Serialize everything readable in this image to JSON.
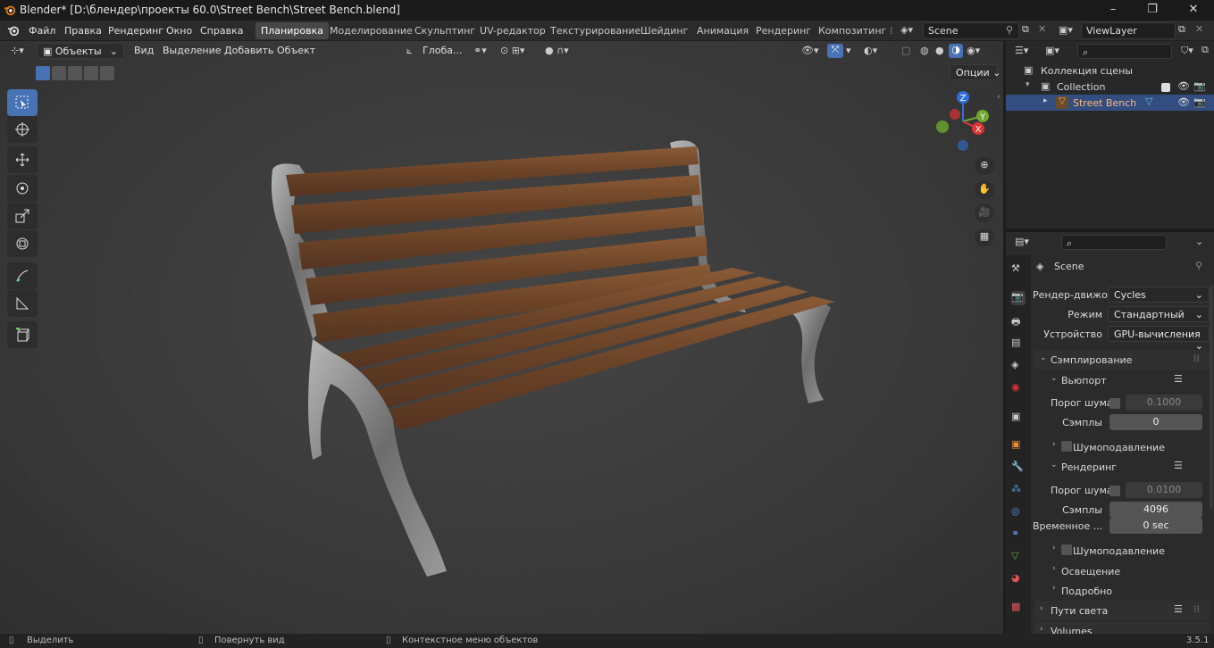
{
  "titlebar": {
    "title": "Blender* [D:\\блендер\\проекты 60.0\\Street Bench\\Street Bench.blend]"
  },
  "menu": [
    "Файл",
    "Правка",
    "Рендеринг",
    "Окно",
    "Справка"
  ],
  "workspaces": [
    "Планировка",
    "Моделирование",
    "Скульптинг",
    "UV-редактор",
    "Текстурирование",
    "Шейдинг",
    "Анимация",
    "Рендеринг",
    "Композитинг"
  ],
  "scene": {
    "name": "Scene",
    "view_layer": "ViewLayer"
  },
  "viewport": {
    "mode": "Объекты",
    "menus": [
      "Вид",
      "Выделение",
      "Добавить",
      "Объект"
    ],
    "orientation": "Глоба...",
    "options": "Опции",
    "gizmo_axes": [
      "Z",
      "Y",
      "X"
    ]
  },
  "outliner": {
    "scene_collection": "Коллекция сцены",
    "collection": "Collection",
    "object": "Street Bench"
  },
  "properties": {
    "context": "Scene",
    "render_engine_label": "Рендер-движок",
    "render_engine": "Cycles",
    "mode_label": "Режим",
    "mode": "Стандартный",
    "device_label": "Устройство",
    "device": "GPU-вычисления",
    "sampling": "Сэмплирование",
    "viewport_section": "Вьюпорт",
    "noise_threshold_label": "Порог шума",
    "viewport_noise_threshold": "0.1000",
    "samples_label": "Сэмплы",
    "viewport_samples": "0",
    "denoise_label": "Шумоподавление",
    "render_section": "Рендеринг",
    "render_noise_threshold": "0.0100",
    "render_samples": "4096",
    "time_limit_label": "Временное ...",
    "time_limit": "0 sec",
    "lighting": "Освещение",
    "advanced": "Подробно",
    "light_paths": "Пути света",
    "volumes": "Volumes"
  },
  "statusbar": {
    "select": "Выделить",
    "rotate": "Повернуть вид",
    "context_menu": "Контекстное меню объектов",
    "version": "3.5.1"
  }
}
